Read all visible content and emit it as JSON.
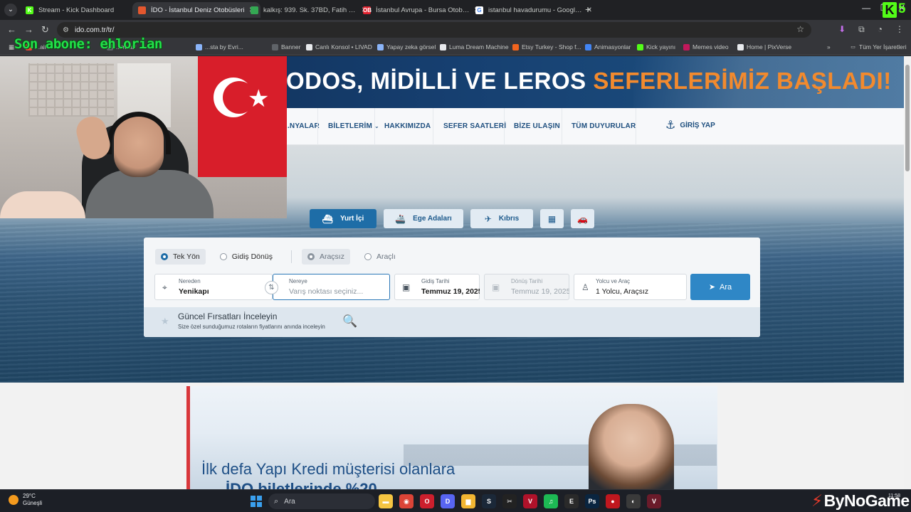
{
  "browser": {
    "tabs": [
      {
        "label": "Stream - Kick Dashboard",
        "icon": "kick-icon",
        "color": "#53fc18",
        "glyph": "K",
        "active": false
      },
      {
        "label": "İDO - İstanbul Deniz Otobüsleri",
        "icon": "ido-icon",
        "color": "#e4572e",
        "glyph": "",
        "active": true
      },
      {
        "label": "kalkış: 939. Sk. 37BD, Fatih Mh...",
        "icon": "maps-pin-icon",
        "color": "#34a853",
        "glyph": "",
        "active": false
      },
      {
        "label": "İstanbul Avrupa - Bursa Otobüs...",
        "icon": "obilet-icon",
        "color": "#e2222f",
        "glyph": "OB",
        "active": false
      },
      {
        "label": "istanbul havadurumu - Google ...",
        "icon": "google-icon",
        "color": "#ffffff",
        "glyph": "G",
        "active": false
      }
    ],
    "new_tab": "+",
    "tab_close": "✕",
    "window_controls": [
      "—",
      "❐",
      "✕"
    ],
    "url": "ido.com.tr/tr/",
    "bookmarks": [
      {
        "label": "...ail",
        "color": "#ea4335"
      },
      {
        "label": "...malar",
        "color": "#5f6368"
      },
      {
        "label": "...sta by Evri...",
        "color": "#8ab4f8"
      },
      {
        "label": "Banner",
        "color": "#5f6368"
      },
      {
        "label": "Canlı Konsol • LIVAD",
        "color": "#e8eaed"
      },
      {
        "label": "Yapay zeka görsel",
        "color": "#8ab4f8"
      },
      {
        "label": "Luma Dream Machine",
        "color": "#e8eaed"
      },
      {
        "label": "Etsy Turkey - Shop f...",
        "color": "#f1641e"
      },
      {
        "label": "Animasyonlar",
        "color": "#4285f4"
      },
      {
        "label": "Kick yayını",
        "color": "#53fc18"
      },
      {
        "label": "Memes video",
        "color": "#c2185b"
      },
      {
        "label": "Home | PixVerse",
        "color": "#e8eaed"
      }
    ],
    "bookmarks_overflow": "»",
    "all_bookmarks": "Tüm Yer İşaretleri"
  },
  "overlay": {
    "subscriber_text": "Son abone: ehlorian",
    "kick_logo": "K",
    "kick_count": "5",
    "watermark": "ByNoGame"
  },
  "banner": {
    "white_text": "ODOS, MİDİLLİ VE LEROS ",
    "orange_text": "SEFERLERİMİZ BAŞLADI!"
  },
  "nav": {
    "items": [
      "...NYALAR",
      "BİLETLERİM",
      "HAKKIMIZDA",
      "SEFER SAATLERİ",
      "BİZE ULAŞIN",
      "TÜM DUYURULAR"
    ],
    "login": "GİRİŞ YAP"
  },
  "service_tabs": [
    {
      "label": "Yurt İçi",
      "icon": "ferry-icon",
      "active": true
    },
    {
      "label": "Ege Adaları",
      "icon": "ship-icon",
      "active": false
    },
    {
      "label": "Kıbrıs",
      "icon": "plane-ship-icon",
      "active": false
    },
    {
      "label": "",
      "icon": "hotel-icon",
      "active": false
    },
    {
      "label": "",
      "icon": "car-icon",
      "active": false
    }
  ],
  "search": {
    "trip_type": {
      "one_way": "Tek Yön",
      "round_trip": "Gidiş Dönüş"
    },
    "vehicle": {
      "without": "Araçsız",
      "with": "Araçlı"
    },
    "from": {
      "label": "Nereden",
      "value": "Yenikapı"
    },
    "to": {
      "label": "Nereye",
      "placeholder": "Varış noktası seçiniz..."
    },
    "depart": {
      "label": "Gidiş Tarihi",
      "value": "Temmuz 19, 2025"
    },
    "return": {
      "label": "Dönüş Tarihi",
      "value": "Temmuz 19, 2025"
    },
    "passenger": {
      "label": "Yolcu ve Araç",
      "value": "1 Yolcu, Araçsız"
    },
    "button": "Ara"
  },
  "deals": {
    "title": "Güncel Fırsatları İnceleyin",
    "subtitle": "Size özel sunduğumuz rotaların fiyatlarını anında inceleyin"
  },
  "ad": {
    "line1": "İlk defa Yapı Kredi müşterisi olanlara",
    "line2": "İDO biletlerinde %20"
  },
  "taskbar": {
    "weather_temp": "29°C",
    "weather_desc": "Güneşli",
    "search_label": "Ara",
    "clock": "11:58",
    "apps": [
      {
        "icon": "explorer-icon",
        "color": "#f5c542",
        "glyph": "▬"
      },
      {
        "icon": "chrome-icon",
        "color": "#db4437",
        "glyph": "◉"
      },
      {
        "icon": "opera-icon",
        "color": "#cc1f2d",
        "glyph": "O"
      },
      {
        "icon": "discord-icon",
        "color": "#5865f2",
        "glyph": "D"
      },
      {
        "icon": "folder-icon",
        "color": "#f2b632",
        "glyph": "▆"
      },
      {
        "icon": "steam-icon",
        "color": "#1b2838",
        "glyph": "S"
      },
      {
        "icon": "capcut-icon",
        "color": "#222222",
        "glyph": "✂"
      },
      {
        "icon": "voicemod-icon",
        "color": "#b0122a",
        "glyph": "V"
      },
      {
        "icon": "spotify-icon",
        "color": "#1db954",
        "glyph": "♫"
      },
      {
        "icon": "epic-icon",
        "color": "#2a2a2a",
        "glyph": "E"
      },
      {
        "icon": "photoshop-icon",
        "color": "#0a2540",
        "glyph": "Ps"
      },
      {
        "icon": "record-icon",
        "color": "#c0171e",
        "glyph": "●"
      },
      {
        "icon": "obs-icon",
        "color": "#3a3a3a",
        "glyph": "◐"
      },
      {
        "icon": "vegas-icon",
        "color": "#6a1b2a",
        "glyph": "V"
      }
    ]
  }
}
